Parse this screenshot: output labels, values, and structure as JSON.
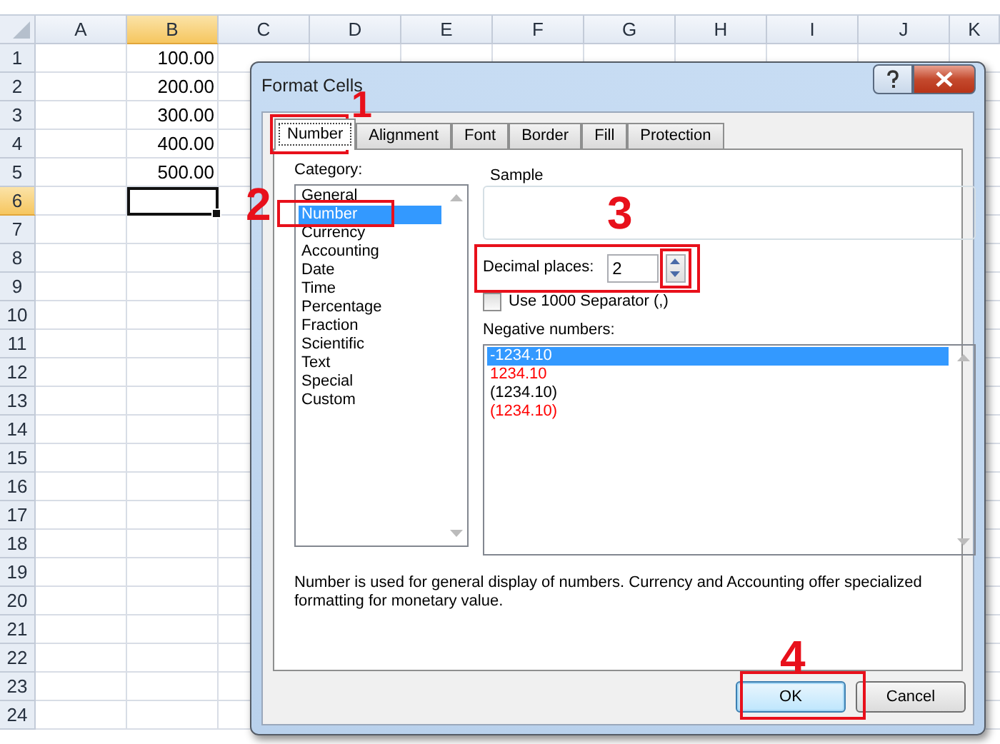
{
  "sheet": {
    "columns": [
      {
        "label": "A",
        "selected": false
      },
      {
        "label": "B",
        "selected": true
      },
      {
        "label": "C",
        "selected": false
      },
      {
        "label": "D",
        "selected": false
      },
      {
        "label": "E",
        "selected": false
      },
      {
        "label": "F",
        "selected": false
      },
      {
        "label": "G",
        "selected": false
      },
      {
        "label": "H",
        "selected": false
      },
      {
        "label": "I",
        "selected": false
      },
      {
        "label": "J",
        "selected": false
      },
      {
        "label": "K",
        "selected": false
      }
    ],
    "rows": [
      {
        "label": "1",
        "selected": false,
        "value_b": "100.00"
      },
      {
        "label": "2",
        "selected": false,
        "value_b": "200.00"
      },
      {
        "label": "3",
        "selected": false,
        "value_b": "300.00"
      },
      {
        "label": "4",
        "selected": false,
        "value_b": "400.00"
      },
      {
        "label": "5",
        "selected": false,
        "value_b": "500.00"
      },
      {
        "label": "6",
        "selected": true
      },
      {
        "label": "7",
        "selected": false
      },
      {
        "label": "8",
        "selected": false
      },
      {
        "label": "9",
        "selected": false
      },
      {
        "label": "10",
        "selected": false
      },
      {
        "label": "11",
        "selected": false
      },
      {
        "label": "12",
        "selected": false
      },
      {
        "label": "13",
        "selected": false
      },
      {
        "label": "14",
        "selected": false
      },
      {
        "label": "15",
        "selected": false
      },
      {
        "label": "16",
        "selected": false
      },
      {
        "label": "17",
        "selected": false
      },
      {
        "label": "18",
        "selected": false
      },
      {
        "label": "19",
        "selected": false
      },
      {
        "label": "20",
        "selected": false
      },
      {
        "label": "21",
        "selected": false
      },
      {
        "label": "22",
        "selected": false
      },
      {
        "label": "23",
        "selected": false
      },
      {
        "label": "24",
        "selected": false
      }
    ]
  },
  "dialog": {
    "title": "Format Cells",
    "tabs": [
      {
        "label": "Number",
        "selected": true
      },
      {
        "label": "Alignment",
        "selected": false
      },
      {
        "label": "Font",
        "selected": false
      },
      {
        "label": "Border",
        "selected": false
      },
      {
        "label": "Fill",
        "selected": false
      },
      {
        "label": "Protection",
        "selected": false
      }
    ],
    "category": {
      "label": "Category:",
      "items": [
        {
          "label": "General",
          "selected": false
        },
        {
          "label": "Number",
          "selected": true
        },
        {
          "label": "Currency",
          "selected": false
        },
        {
          "label": "Accounting",
          "selected": false
        },
        {
          "label": "Date",
          "selected": false
        },
        {
          "label": "Time",
          "selected": false
        },
        {
          "label": "Percentage",
          "selected": false
        },
        {
          "label": "Fraction",
          "selected": false
        },
        {
          "label": "Scientific",
          "selected": false
        },
        {
          "label": "Text",
          "selected": false
        },
        {
          "label": "Special",
          "selected": false
        },
        {
          "label": "Custom",
          "selected": false
        }
      ]
    },
    "sample": {
      "label": "Sample"
    },
    "decimal_places": {
      "label": "Decimal places:",
      "value": "2"
    },
    "separator": {
      "label": "Use 1000 Separator (,)",
      "checked": false
    },
    "negative_numbers": {
      "label": "Negative numbers:",
      "items": [
        {
          "label": "-1234.10",
          "selected": true
        },
        {
          "label": "1234.10",
          "selected": false,
          "color": "#ff0000"
        },
        {
          "label": "(1234.10)",
          "selected": false,
          "color": "#000000"
        },
        {
          "label": "(1234.10)",
          "selected": false,
          "color": "#ff0000"
        }
      ]
    },
    "description": "Number is used for general display of numbers.  Currency and Accounting offer specialized formatting for monetary value.",
    "buttons": [
      {
        "label": "OK",
        "default": true
      },
      {
        "label": "Cancel",
        "default": false
      }
    ]
  },
  "annotations": [
    {
      "label": "1"
    },
    {
      "label": "2"
    },
    {
      "label": "3"
    },
    {
      "label": "4"
    }
  ]
}
